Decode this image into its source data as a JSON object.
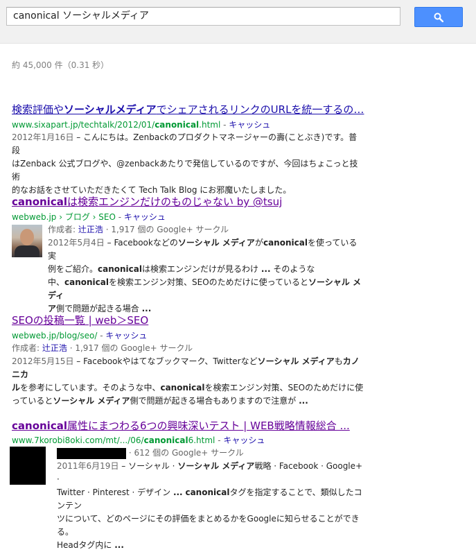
{
  "search": {
    "query": "canonical ソーシャルメディア"
  },
  "stats": "約 45,000 件（0.31 秒）",
  "results": [
    {
      "title_plain_1": "検索評価や",
      "title_bold_1": "ソーシャルメディア",
      "title_plain_2": "でシェアされるリンクのURLを統一するの…",
      "url_plain": "www.sixapart.jp/techtalk/2012/01/",
      "url_bold": "canonical",
      "url_tail": ".html",
      "sep": " - ",
      "cache": "キャッシュ",
      "date": "2012年1月16日",
      "snippet_1": " – こんにちは。Zenbackのプロダクトマネージャーの壽(ことぶき)です。普段",
      "snippet_2": "はZenback 公式ブログや、@zenbackあたりで発信しているのですが、今回はちょこっと技術",
      "snippet_3": "的なお話をさせていただきたくて Tech Talk Blog にお邪魔いたしました。"
    },
    {
      "title_bold_1": "canonical",
      "title_plain_1": "は検索エンジンだけのものじゃない by @tsuj",
      "url_plain": "webweb.jp › ブログ › SEO",
      "sep": " - ",
      "cache": "キャッシュ",
      "author_prefix": "作成者: ",
      "author_name": "辻正浩",
      "author_suffix": " · 1,917 個の Google+ サークル",
      "date": "2012年5月4日",
      "s1a": " – Facebookなどの",
      "s1b": "ソーシャル メディア",
      "s1c": "が",
      "s1d": "canonical",
      "s1e": "を使っている実",
      "s2a": "例をご紹介。",
      "s2b": "canonical",
      "s2c": "は検索エンジンだけが見るわけ ",
      "s2d": "...",
      "s2e": " そのような",
      "s3a": "中、",
      "s3b": "canonical",
      "s3c": "を検索エンジン対策、SEOのためだけに使っていると",
      "s3d": "ソーシャル メディ",
      "s4a": "ア",
      "s4b": "側で問題が起きる場合 ",
      "s4c": "..."
    },
    {
      "title": "SEOの投稿一覧 | web＞SEO",
      "url_plain": "webweb.jp/blog/seo/",
      "sep": " - ",
      "cache": "キャッシュ",
      "author_prefix": "作成者: ",
      "author_name": "辻正浩",
      "author_suffix": " · 1,917 個の Google+ サークル",
      "date": "2012年5月15日",
      "s1a": " – Facebookやはてなブックマーク、Twitterなど",
      "s1b": "ソーシャル メディア",
      "s1c": "も",
      "s1d": "カノニカ",
      "s2a": "ル",
      "s2b": "を参考にしています。そのような中、",
      "s2c": "canonical",
      "s2d": "を検索エンジン対策、SEOのためだけに使",
      "s3a": "っていると",
      "s3b": "ソーシャル メディア",
      "s3c": "側で問題が起きる場合もありますので注意が ",
      "s3d": "..."
    },
    {
      "title_bold_1": "canonical",
      "title_plain_1": "属性にまつわる6つの興味深いテスト | WEB戦略情報総合 ...",
      "url_plain": "www.7korobi8oki.com/mt/.../06/",
      "url_bold": "canonical",
      "url_tail": "6.html",
      "sep": " - ",
      "cache": "キャッシュ",
      "author_suffix": " · 612 個の Google+ サークル",
      "date": "2011年6月19日",
      "s1a": " – ソーシャル ",
      "s1b": "·",
      "s1c": " ",
      "s1d": "ソーシャル メディア",
      "s1e": "戦略 · Facebook · Google+ ·",
      "s2a": "Twitter · Pinterest · デザイン ",
      "s2b": "...",
      "s2c": " ",
      "s2d": "canonical",
      "s2e": "タグを指定することで、類似したコンテン",
      "s3a": "ツについて、どのページにその評価をまとめるかをGoogleに知らせることができる。",
      "s4a": "Headタグ内に ",
      "s4b": "..."
    }
  ],
  "icons": {
    "search_button_icon": "magnifier-icon"
  },
  "colors": {
    "link": "#1a0dab",
    "visited": "#660099",
    "url_green": "#009933",
    "button_blue": "#4d90fe"
  }
}
